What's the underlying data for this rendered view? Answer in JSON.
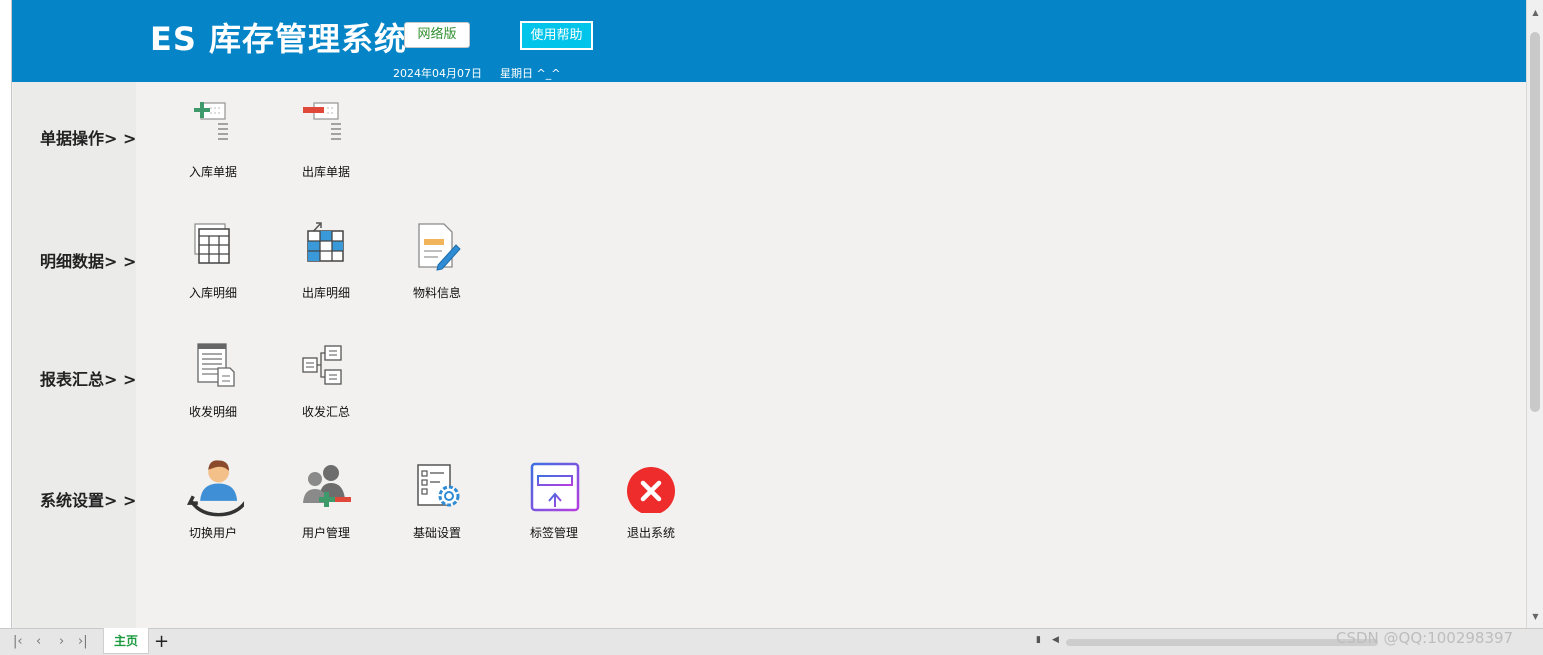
{
  "header": {
    "title": "ES 库存管理系统",
    "edition_label": "网络版",
    "help_label": "使用帮助",
    "date": "2024年04月07日",
    "weekday": "星期日   ^_^"
  },
  "sections": {
    "docs": {
      "label": "单据操作> >",
      "items": [
        "入库单据",
        "出库单据"
      ]
    },
    "details": {
      "label": "明细数据> >",
      "items": [
        "入库明细",
        "出库明细",
        "物料信息"
      ]
    },
    "reports": {
      "label": "报表汇总> >",
      "items": [
        "收发明细",
        "收发汇总"
      ]
    },
    "settings": {
      "label": "系统设置> >",
      "items": [
        "切换用户",
        "用户管理",
        "基础设置",
        "标签管理",
        "退出系统"
      ]
    }
  },
  "footer": {
    "sheet_tab": "主页",
    "add_tab": "+",
    "watermark": "CSDN @QQ:100298397"
  },
  "colors": {
    "header_bg": "#0585c7",
    "help_button_bg": "#00c4ea",
    "sidebar_bg": "#ebebea",
    "content_bg": "#f2f1ef",
    "tab_text": "#1b9a3f",
    "exit_red": "#ee2c2c"
  }
}
